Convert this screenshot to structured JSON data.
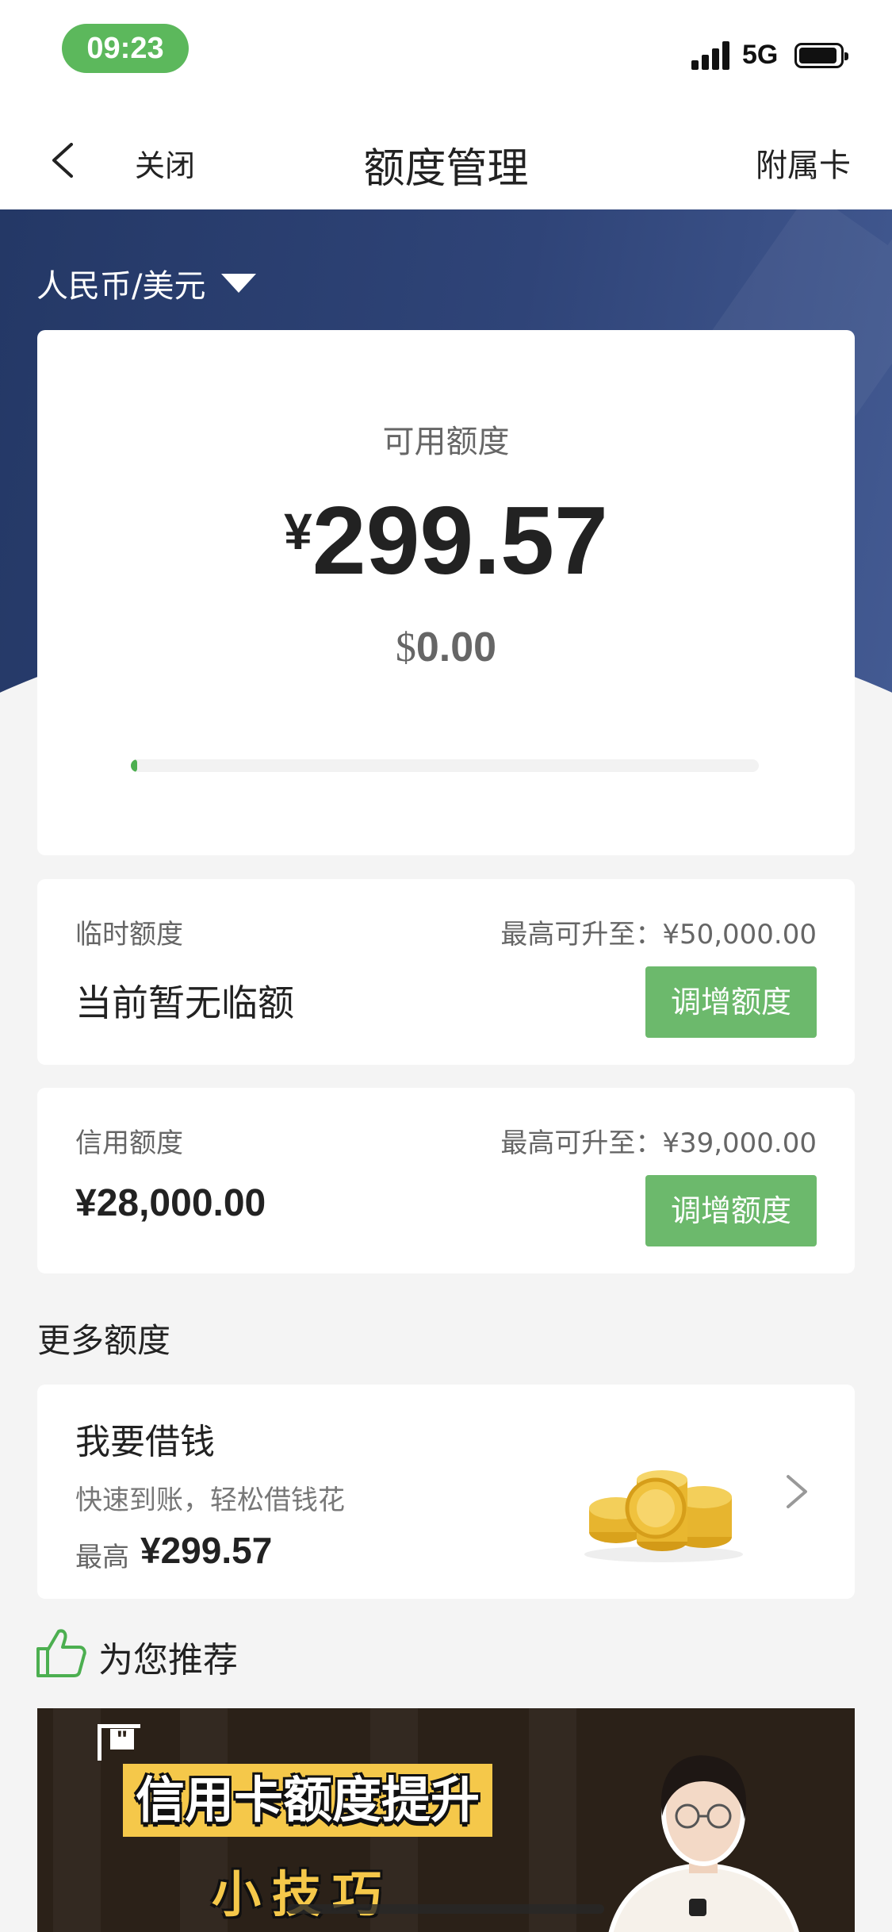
{
  "status_bar": {
    "time": "09:23",
    "network": "5G"
  },
  "nav": {
    "close_label": "关闭",
    "title": "额度管理",
    "right_label": "附属卡"
  },
  "currency_selector": {
    "label": "人民币/美元"
  },
  "available": {
    "label": "可用额度",
    "rmb_symbol": "¥",
    "rmb_value": "299.57",
    "usd_symbol": "$",
    "usd_value": "0.00",
    "usage_fraction": 0.01
  },
  "temp_limit": {
    "title": "临时额度",
    "max_text": "最高可升至：¥50,000.00",
    "value": "当前暂无临额",
    "button": "调增额度"
  },
  "credit_limit": {
    "title": "信用额度",
    "max_text": "最高可升至：¥39,000.00",
    "value": "¥28,000.00",
    "button": "调增额度"
  },
  "more_limits": {
    "section_title": "更多额度",
    "borrow": {
      "title": "我要借钱",
      "desc": "快速到账，轻松借钱花",
      "max_label": "最高",
      "max_value": "¥299.57"
    }
  },
  "recommend": {
    "section_title": "为您推荐",
    "video": {
      "line1": "信用卡额度提升",
      "line2": "小技巧"
    }
  },
  "colors": {
    "accent_green": "#6cb96c",
    "header_blue": "#2f4478",
    "status_pill": "#5cb85c"
  }
}
